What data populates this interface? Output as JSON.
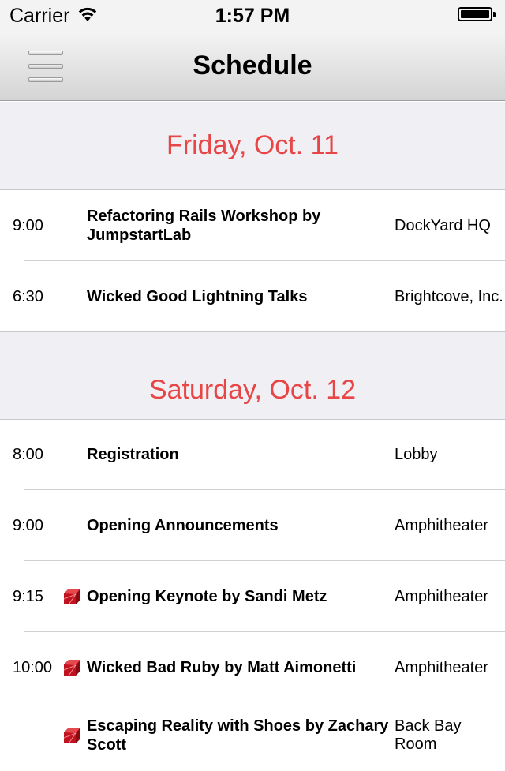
{
  "status_bar": {
    "carrier": "Carrier",
    "time": "1:57 PM"
  },
  "nav": {
    "title": "Schedule",
    "menu_icon": "hamburger-menu-icon"
  },
  "accent_color": "#e84546",
  "days": [
    {
      "label": "Friday, Oct. 11",
      "sessions": [
        {
          "time": "9:00",
          "title": "Refactoring Rails Workshop by JumpstartLab",
          "venue": "DockYard HQ",
          "ruby_icon": false
        },
        {
          "time": "6:30",
          "title": "Wicked Good Lightning Talks",
          "venue": "Brightcove, Inc.",
          "ruby_icon": false
        }
      ]
    },
    {
      "label": "Saturday, Oct. 12",
      "sessions": [
        {
          "time": "8:00",
          "title": "Registration",
          "venue": "Lobby",
          "ruby_icon": false
        },
        {
          "time": "9:00",
          "title": "Opening Announcements",
          "venue": "Amphitheater",
          "ruby_icon": false
        },
        {
          "time": "9:15",
          "title": "Opening Keynote by Sandi Metz",
          "venue": "Amphitheater",
          "ruby_icon": true
        },
        {
          "time": "10:00",
          "title": "Wicked Bad Ruby by Matt Aimonetti",
          "venue": "Amphitheater",
          "ruby_icon": true
        },
        {
          "time": "",
          "title": "Escaping Reality with Shoes by Zachary Scott",
          "venue": "Back Bay Room",
          "ruby_icon": true
        }
      ]
    }
  ]
}
